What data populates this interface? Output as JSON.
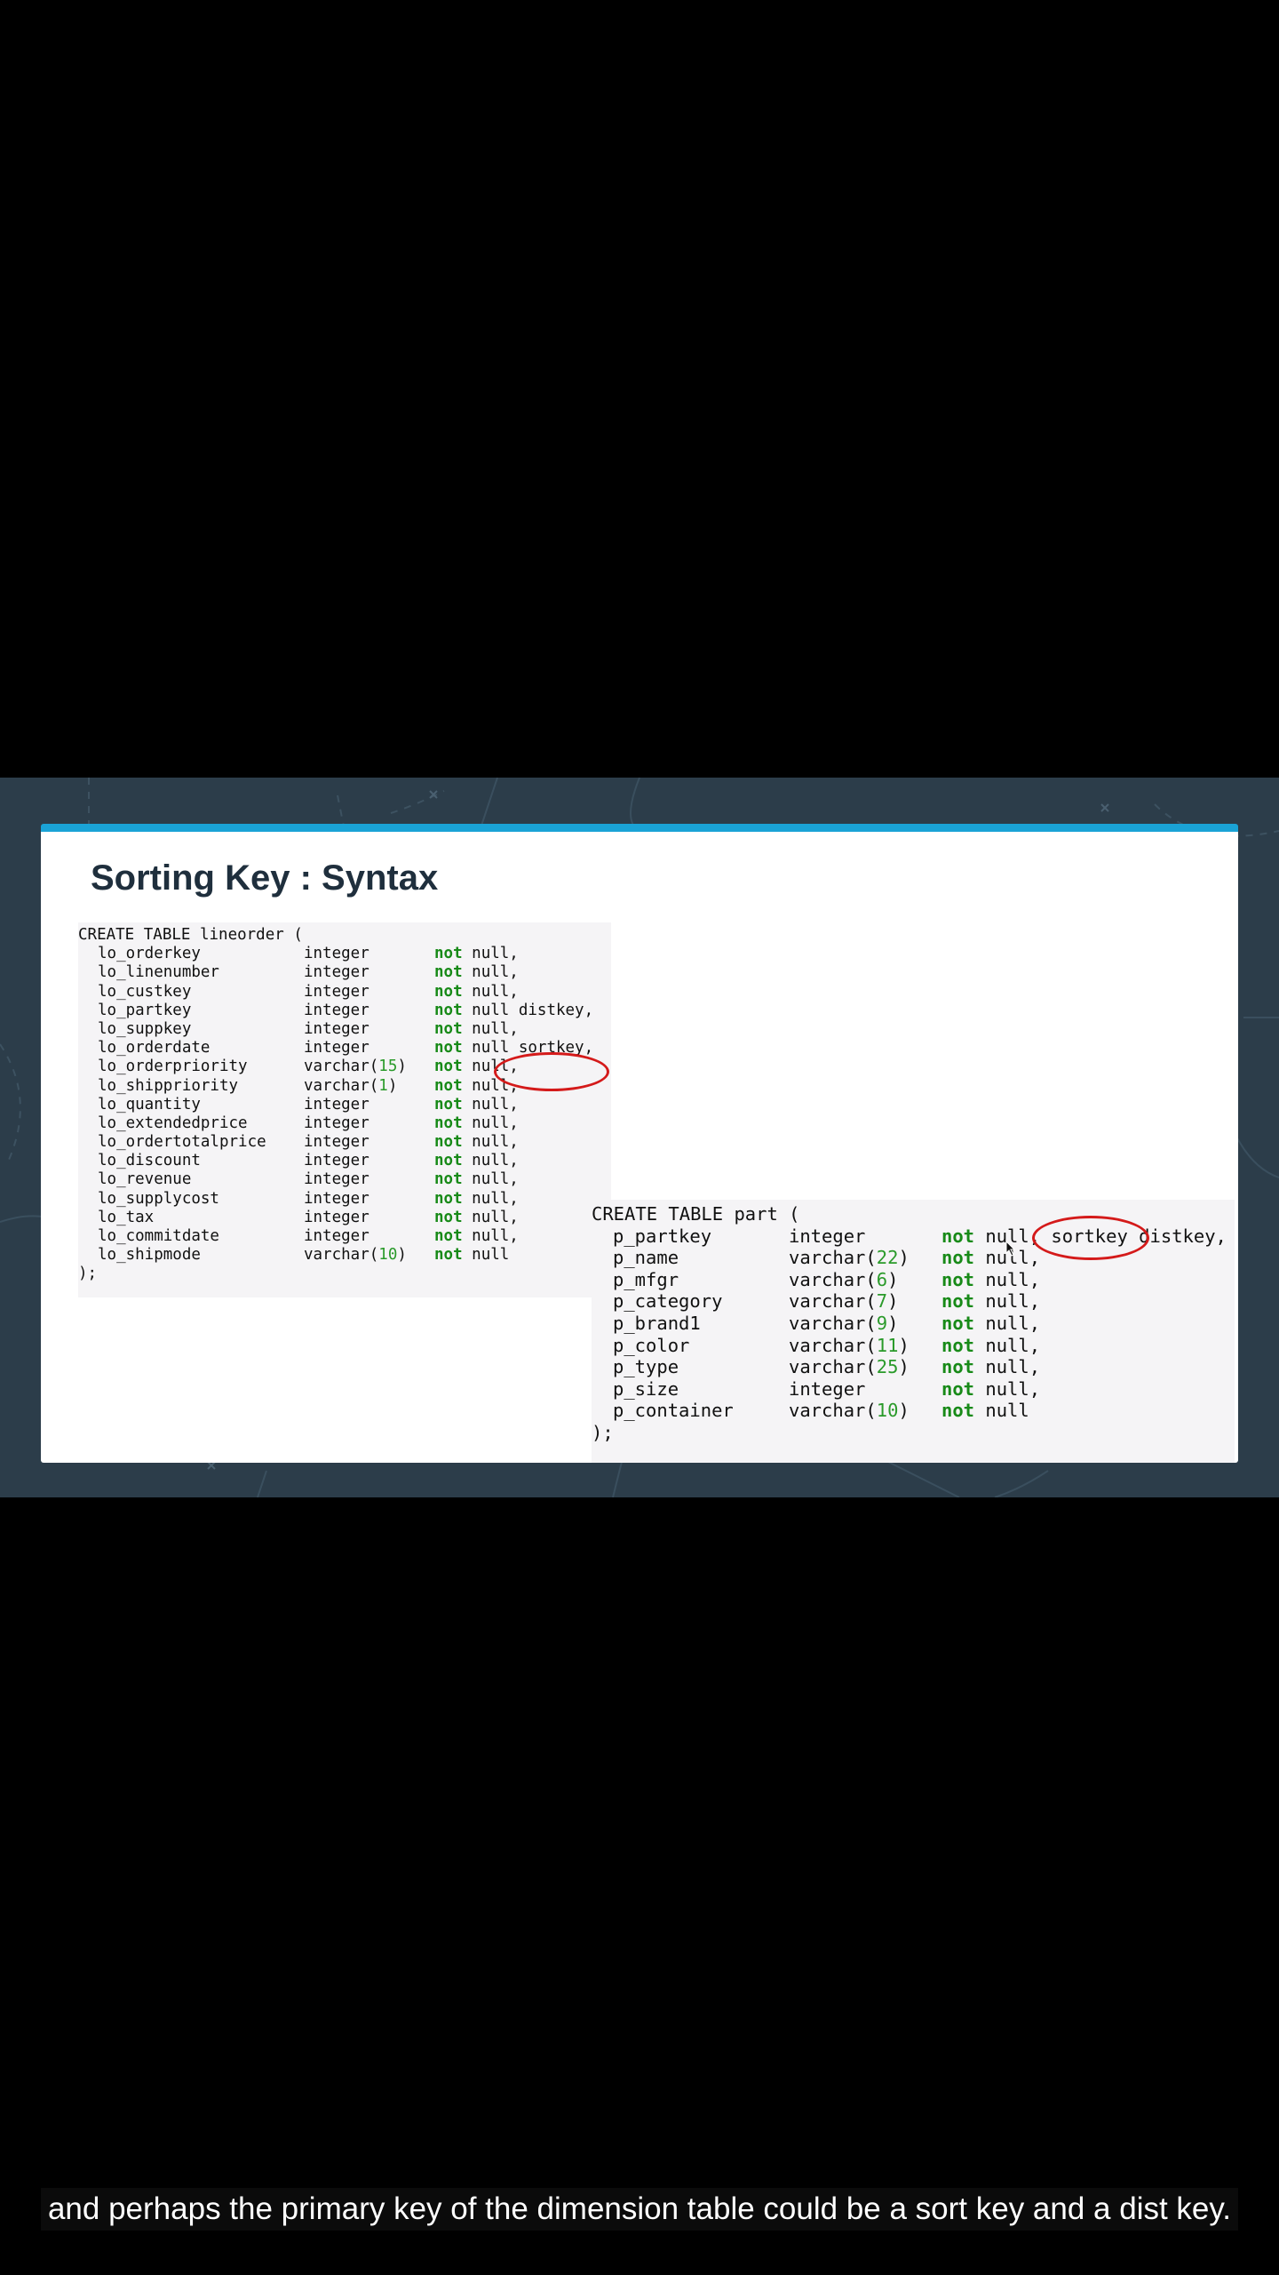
{
  "slide": {
    "title": "Sorting Key : Syntax",
    "lineorder": {
      "header": "CREATE TABLE lineorder (",
      "footer": ");",
      "rows": [
        {
          "name": "lo_orderkey",
          "type": "integer",
          "len": "",
          "kw": "not",
          "rest": "null,"
        },
        {
          "name": "lo_linenumber",
          "type": "integer",
          "len": "",
          "kw": "not",
          "rest": "null,"
        },
        {
          "name": "lo_custkey",
          "type": "integer",
          "len": "",
          "kw": "not",
          "rest": "null,"
        },
        {
          "name": "lo_partkey",
          "type": "integer",
          "len": "",
          "kw": "not",
          "rest": "null distkey,"
        },
        {
          "name": "lo_suppkey",
          "type": "integer",
          "len": "",
          "kw": "not",
          "rest": "null,"
        },
        {
          "name": "lo_orderdate",
          "type": "integer",
          "len": "",
          "kw": "not",
          "rest": "null sortkey,"
        },
        {
          "name": "lo_orderpriority",
          "type": "varchar(",
          "len": "15",
          "kw": "not",
          "rest": "null,"
        },
        {
          "name": "lo_shippriority",
          "type": "varchar(",
          "len": "1",
          "kw": "not",
          "rest": "null,"
        },
        {
          "name": "lo_quantity",
          "type": "integer",
          "len": "",
          "kw": "not",
          "rest": "null,"
        },
        {
          "name": "lo_extendedprice",
          "type": "integer",
          "len": "",
          "kw": "not",
          "rest": "null,"
        },
        {
          "name": "lo_ordertotalprice",
          "type": "integer",
          "len": "",
          "kw": "not",
          "rest": "null,"
        },
        {
          "name": "lo_discount",
          "type": "integer",
          "len": "",
          "kw": "not",
          "rest": "null,"
        },
        {
          "name": "lo_revenue",
          "type": "integer",
          "len": "",
          "kw": "not",
          "rest": "null,"
        },
        {
          "name": "lo_supplycost",
          "type": "integer",
          "len": "",
          "kw": "not",
          "rest": "null,"
        },
        {
          "name": "lo_tax",
          "type": "integer",
          "len": "",
          "kw": "not",
          "rest": "null,"
        },
        {
          "name": "lo_commitdate",
          "type": "integer",
          "len": "",
          "kw": "not",
          "rest": "null,"
        },
        {
          "name": "lo_shipmode",
          "type": "varchar(",
          "len": "10",
          "kw": "not",
          "rest": "null"
        }
      ]
    },
    "part": {
      "header": "CREATE TABLE part (",
      "footer": ");",
      "rows": [
        {
          "name": "p_partkey",
          "type": "integer",
          "len": "",
          "kw": "not",
          "rest": "null, sortkey distkey,"
        },
        {
          "name": "p_name",
          "type": "varchar(",
          "len": "22",
          "kw": "not",
          "rest": "null,"
        },
        {
          "name": "p_mfgr",
          "type": "varchar(",
          "len": "6",
          "kw": "not",
          "rest": "null,"
        },
        {
          "name": "p_category",
          "type": "varchar(",
          "len": "7",
          "kw": "not",
          "rest": "null,"
        },
        {
          "name": "p_brand1",
          "type": "varchar(",
          "len": "9",
          "kw": "not",
          "rest": "null,"
        },
        {
          "name": "p_color",
          "type": "varchar(",
          "len": "11",
          "kw": "not",
          "rest": "null,"
        },
        {
          "name": "p_type",
          "type": "varchar(",
          "len": "25",
          "kw": "not",
          "rest": "null,"
        },
        {
          "name": "p_size",
          "type": "integer",
          "len": "",
          "kw": "not",
          "rest": "null,"
        },
        {
          "name": "p_container",
          "type": "varchar(",
          "len": "10",
          "kw": "not",
          "rest": "null"
        }
      ]
    }
  },
  "subtitle": "and perhaps the primary key of the dimension table could be a sort key and a dist key.",
  "colors": {
    "accent_bar": "#1aa3d6",
    "keyword": "#188a18",
    "highlight": "#d41a1a",
    "frame_bg": "#2c3d4a"
  }
}
